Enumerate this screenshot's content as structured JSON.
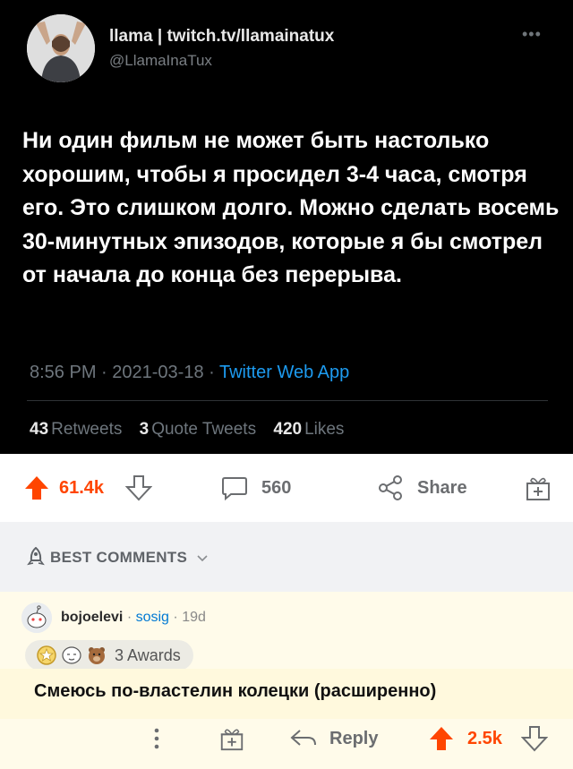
{
  "tweet": {
    "display_name": "llama | twitch.tv/llamainatux",
    "handle": "@LlamaInaTux",
    "more_icon": "more-icon",
    "text": "Ни один фильм не может быть настолько хорошим, чтобы я просидел 3-4 часа, смотря его. Это слишком долго. Можно сделать восемь 30-минутных эпизодов, которые я бы смотрел от начала до конца без перерыва.",
    "time": "8:56 PM",
    "date": "2021-03-18",
    "app": "Twitter Web App",
    "retweets": "43",
    "retweets_label": "Retweets",
    "quotes": "3",
    "quotes_label": "Quote Tweets",
    "likes": "420",
    "likes_label": "Likes"
  },
  "post_actions": {
    "upvotes": "61.4k",
    "comments": "560",
    "share_label": "Share",
    "upvote_color": "#ff4500"
  },
  "sort": {
    "label": "BEST COMMENTS"
  },
  "comment": {
    "username": "bojoelevi",
    "flair": "sosig",
    "age": "19d",
    "awards": "3 Awards",
    "text": "Смеюсь по-властелин колецки (расширенно)",
    "reply_label": "Reply",
    "score": "2.5k"
  }
}
